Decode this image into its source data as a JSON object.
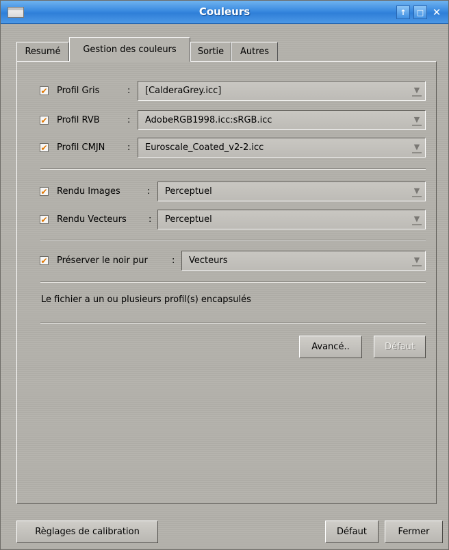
{
  "window": {
    "title": "Couleurs",
    "controls": {
      "up": "↑",
      "maximize": "□",
      "close": "✕"
    }
  },
  "tabs": [
    {
      "label": "Resumé",
      "active": false
    },
    {
      "label": "Gestion des couleurs",
      "active": true
    },
    {
      "label": "Sortie",
      "active": false
    },
    {
      "label": "Autres",
      "active": false
    }
  ],
  "settings": {
    "checkmark": "✔",
    "colon": ":",
    "arrow": "▼",
    "profil_gris": {
      "label": "Profil Gris",
      "checked": true,
      "value": "[CalderaGrey.icc]"
    },
    "profil_rvb": {
      "label": "Profil RVB",
      "checked": true,
      "value": "AdobeRGB1998.icc:sRGB.icc"
    },
    "profil_cmjn": {
      "label": "Profil CMJN",
      "checked": true,
      "value": "Euroscale_Coated_v2-2.icc"
    },
    "rendu_images": {
      "label": "Rendu Images",
      "checked": true,
      "value": "Perceptuel"
    },
    "rendu_vecteurs": {
      "label": "Rendu Vecteurs",
      "checked": true,
      "value": "Perceptuel"
    },
    "preserver_noir": {
      "label": "Préserver le noir pur",
      "checked": true,
      "value": "Vecteurs"
    },
    "info": "Le fichier a un ou plusieurs profil(s) encapsulés",
    "avance_label": "Avancé..",
    "defaut_label": "Défaut"
  },
  "footer": {
    "calibration_label": "Règlages de calibration",
    "defaut_label": "Défaut",
    "fermer_label": "Fermer"
  },
  "colors": {
    "titlebar": "#3a8ae0",
    "checkmark": "#e07600",
    "background": "#b3b1ab"
  },
  "icons": {
    "window": "window-icon",
    "dropdown": "chevron-down-icon",
    "check": "checkmark-icon"
  }
}
